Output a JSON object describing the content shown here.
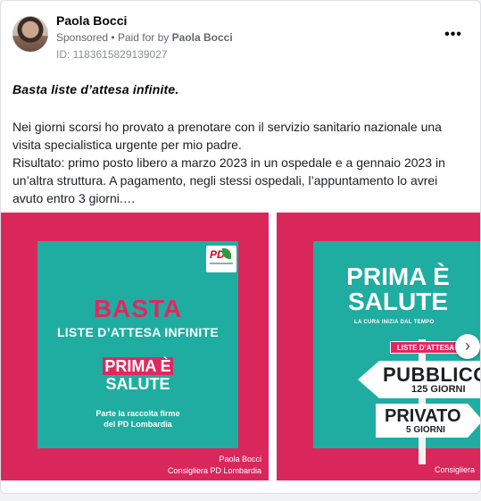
{
  "post": {
    "author": "Paola Bocci",
    "sponsored": "Sponsored",
    "separator": "•",
    "paid_for_prefix": "Paid for by",
    "paid_for_name": "Paola Bocci",
    "ad_id": "ID: 1183615829139027",
    "more_icon": "more-options-icon",
    "more_glyph": "•••",
    "headline": "Basta liste d’attesa infinite",
    "headline_end": ".",
    "body_lines": [
      "Nei giorni scorsi ho provato a prenotare con il servizio sanitario nazionale una visita specialistica urgente per mio padre.",
      "Risultato: primo posto libero a marzo 2023 in un ospedale e a gennaio 2023 in un’altra struttura. A pagamento, negli stessi ospedali, l’appuntamento lo avrei avuto entro 3 giorni.…"
    ]
  },
  "carousel": {
    "slide1": {
      "logo_text": "PD",
      "basta": "BASTA",
      "liste": "LISTE D’ATTESA INFINITE",
      "brand_top": "PRIMA È",
      "brand_bottom": "SALUTE",
      "firme_line1": "Parte la raccolta firme",
      "firme_line2": "del PD Lombardia",
      "credit_name": "Paola Bocci",
      "credit_role": "Consigliera PD Lombardia"
    },
    "slide2": {
      "brand_top": "PRIMA È",
      "brand_bottom": "SALUTE",
      "tagline": "LA CURA INIZIA DAL TEMPO",
      "liste_sign": "LISTE D’ATTESA",
      "pubblico": "PUBBLICO",
      "pubblico_days": "125 GIORNI",
      "privato": "PRIVATO",
      "privato_days": "5 GIORNI",
      "credit_role": "Consigliera"
    },
    "next_glyph": "›",
    "next_icon": "chevron-right-icon"
  },
  "colors": {
    "pink": "#d9275c",
    "teal": "#1fada1",
    "accent": "#e0285f"
  }
}
